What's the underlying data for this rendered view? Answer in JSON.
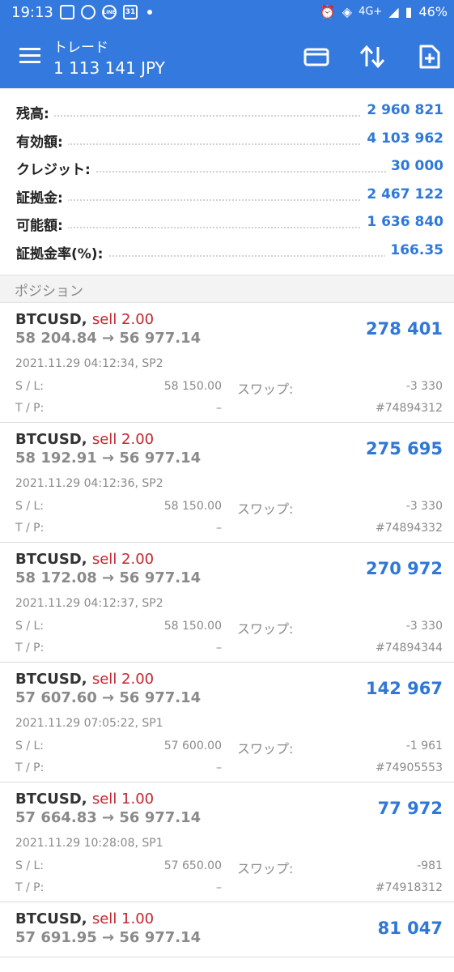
{
  "status_bar": {
    "time": "19:13",
    "calendar_day": "31",
    "line_badge": "LINE",
    "network": "4G+",
    "battery": "46%"
  },
  "app_bar": {
    "title": "トレード",
    "balance_line": "1 113 141 JPY",
    "accent_color": "#3479dd"
  },
  "summary": [
    {
      "label": "残高:",
      "value": "2 960 821"
    },
    {
      "label": "有効額:",
      "value": "4 103 962"
    },
    {
      "label": "クレジット:",
      "value": "30 000"
    },
    {
      "label": "証拠金:",
      "value": "2 467 122"
    },
    {
      "label": "可能額:",
      "value": "1 636 840"
    },
    {
      "label": "証拠金率(%):",
      "value": "166.35"
    }
  ],
  "section_title": "ポジション",
  "labels": {
    "sl": "S / L:",
    "tp": "T / P:",
    "swap": "スワップ:"
  },
  "positions": [
    {
      "symbol": "BTCUSD,",
      "side": "sell 2.00",
      "prices": "58 204.84 → 56 977.14",
      "profit": "278 401",
      "time": "2021.11.29 04:12:34, SP2",
      "sl": "58 150.00",
      "tp": "–",
      "swap": "-3 330",
      "ticket": "#74894312"
    },
    {
      "symbol": "BTCUSD,",
      "side": "sell 2.00",
      "prices": "58 192.91 → 56 977.14",
      "profit": "275 695",
      "time": "2021.11.29 04:12:36, SP2",
      "sl": "58 150.00",
      "tp": "–",
      "swap": "-3 330",
      "ticket": "#74894332"
    },
    {
      "symbol": "BTCUSD,",
      "side": "sell 2.00",
      "prices": "58 172.08 → 56 977.14",
      "profit": "270 972",
      "time": "2021.11.29 04:12:37, SP2",
      "sl": "58 150.00",
      "tp": "–",
      "swap": "-3 330",
      "ticket": "#74894344"
    },
    {
      "symbol": "BTCUSD,",
      "side": "sell 2.00",
      "prices": "57 607.60 → 56 977.14",
      "profit": "142 967",
      "time": "2021.11.29 07:05:22, SP1",
      "sl": "57 600.00",
      "tp": "–",
      "swap": "-1 961",
      "ticket": "#74905553"
    },
    {
      "symbol": "BTCUSD,",
      "side": "sell 1.00",
      "prices": "57 664.83 → 56 977.14",
      "profit": "77 972",
      "time": "2021.11.29 10:28:08, SP1",
      "sl": "57 650.00",
      "tp": "–",
      "swap": "-981",
      "ticket": "#74918312"
    },
    {
      "symbol": "BTCUSD,",
      "side": "sell 1.00",
      "prices": "57 691.95 → 56 977.14",
      "profit": "81 047"
    }
  ]
}
